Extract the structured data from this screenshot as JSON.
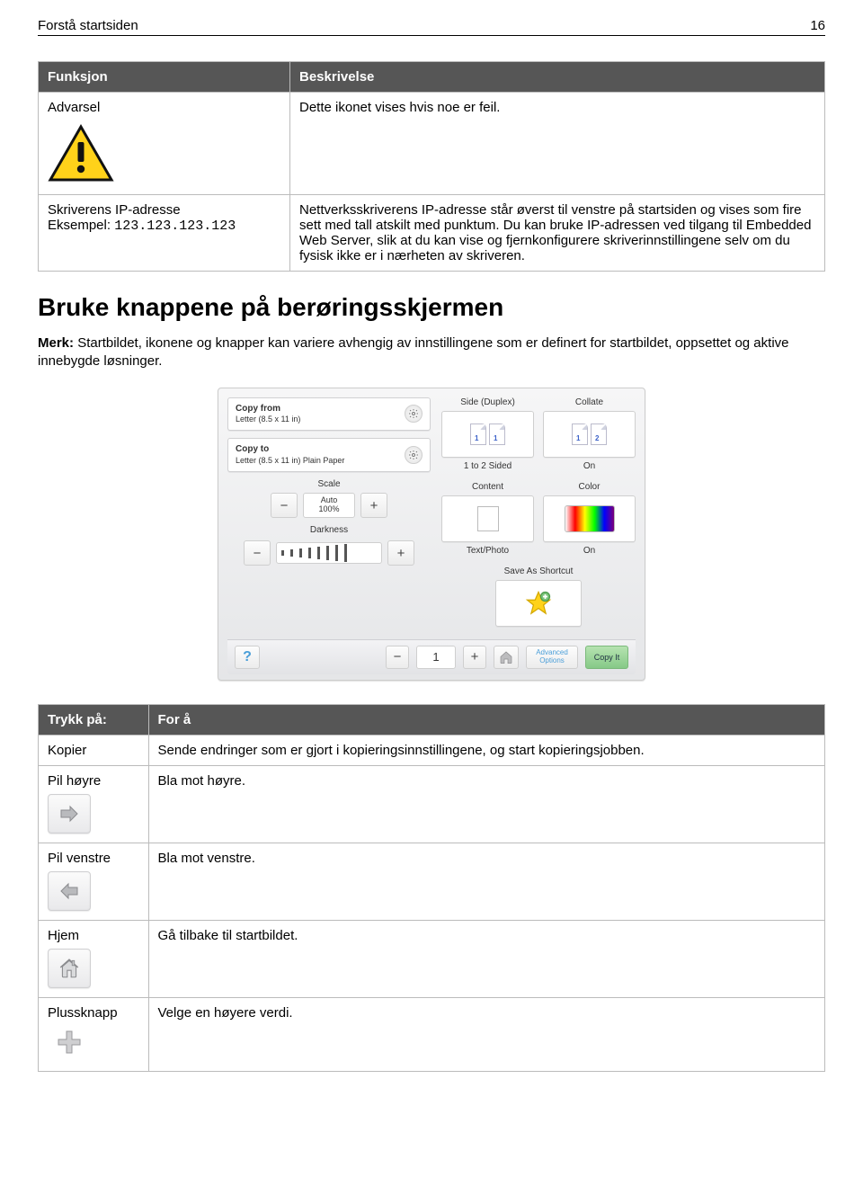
{
  "page": {
    "header": "Forstå startsiden",
    "number": "16"
  },
  "table1": {
    "h1": "Funksjon",
    "h2": "Beskrivelse",
    "r1c1": "Advarsel",
    "r1c2": "Dette ikonet vises hvis noe er feil.",
    "r2c1a": "Skriverens IP-adresse",
    "r2c1b_label": "Eksempel: ",
    "r2c1b_code": "123.123.123.123",
    "r2c2": "Nettverksskriverens IP-adresse står øverst til venstre på startsiden og vises som fire sett med tall atskilt med punktum. Du kan bruke IP-adressen ved tilgang til Embedded Web Server, slik at du kan vise og fjernkonfigurere skriverinnstillingene selv om du fysisk ikke er i nærheten av skriveren."
  },
  "section": {
    "heading": "Bruke knappene på berøringsskjermen",
    "note_lead": "Merk: ",
    "note_body": "Startbildet, ikonene og knapper kan variere avhengig av innstillingene som er definert for startbildet, oppsettet og aktive innebygde løsninger."
  },
  "panel": {
    "copy_from_hd": "Copy from",
    "copy_from_sub": "Letter (8.5 x 11 in)",
    "copy_to_hd": "Copy to",
    "copy_to_sub": "Letter (8.5 x 11 in) Plain Paper",
    "scale_label": "Scale",
    "scale_auto": "Auto",
    "scale_val": "100%",
    "darkness_label": "Darkness",
    "side_label": "Side (Duplex)",
    "side_val": "1 to 2 Sided",
    "collate_label": "Collate",
    "collate_val": "On",
    "content_label": "Content",
    "content_val": "Text/Photo",
    "color_label": "Color",
    "color_val": "On",
    "save_label": "Save As Shortcut",
    "count": "1",
    "adv": "Advanced Options",
    "go": "Copy It"
  },
  "table2": {
    "h1": "Trykk på:",
    "h2": "For å",
    "r1c1": "Kopier",
    "r1c2": "Sende endringer som er gjort i kopieringsinnstillingene, og start kopieringsjobben.",
    "r2c1": "Pil høyre",
    "r2c2": "Bla mot høyre.",
    "r3c1": "Pil venstre",
    "r3c2": "Bla mot venstre.",
    "r4c1": "Hjem",
    "r4c2": "Gå tilbake til startbildet.",
    "r5c1": "Plussknapp",
    "r5c2": "Velge en høyere verdi."
  }
}
